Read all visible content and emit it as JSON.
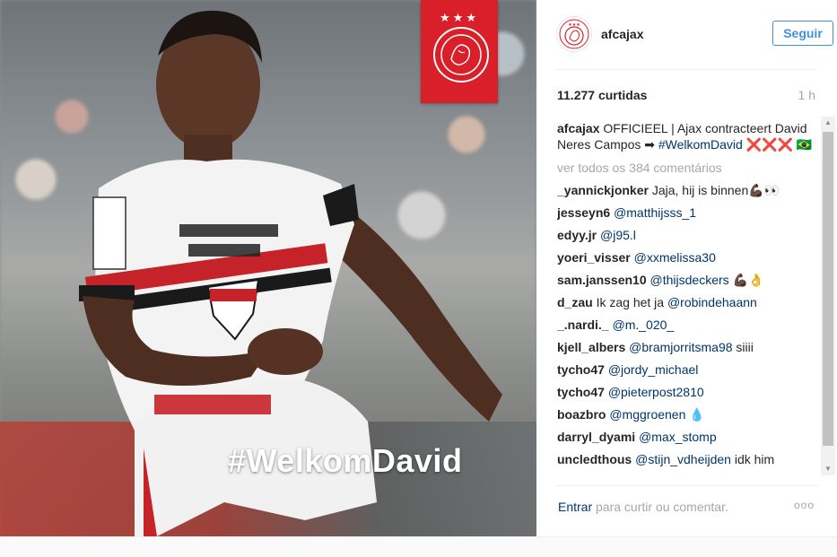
{
  "photo": {
    "hashtag_overlay": "#WelkomDavid",
    "badge_stars": "★★★"
  },
  "post": {
    "username": "afcajax",
    "follow_label": "Seguir",
    "likes": "11.277 curtidas",
    "time": "1 h",
    "caption": {
      "user": "afcajax",
      "text_before": " OFFICIEEL | Ajax contracteert David Neres Campos ➡ ",
      "hashtag": "#WelkomDavid",
      "text_after": " ❌❌❌ 🇧🇷"
    },
    "view_all": "ver todos os 384 comentários",
    "comments": [
      {
        "user": "_yannickjonker",
        "text": " Jaja, hij is binnen💪🏿👀"
      },
      {
        "user": "jesseyn6",
        "mention": "@matthijsss_1",
        "text": ""
      },
      {
        "user": "edyy.jr",
        "mention": "@j95.l",
        "text": ""
      },
      {
        "user": "yoeri_visser",
        "mention": "@xxmelissa30",
        "text": ""
      },
      {
        "user": "sam.janssen10",
        "mention": "@thijsdeckers",
        "text": " 💪🏿👌"
      },
      {
        "user": "d_zau",
        "text": " Ik zag het ja ",
        "mention": "@robindehaann"
      },
      {
        "user": "_.nardi._",
        "mention": "@m._020_",
        "text": ""
      },
      {
        "user": "kjell_albers",
        "mention": "@bramjorritsma98",
        "text": " siiii"
      },
      {
        "user": "tycho47",
        "mention": "@jordy_michael",
        "text": ""
      },
      {
        "user": "tycho47",
        "mention": "@pieterpost2810",
        "text": ""
      },
      {
        "user": "boazbro",
        "mention": "@mggroenen",
        "text": " 💧"
      },
      {
        "user": "darryl_dyami",
        "mention": "@max_stomp",
        "text": ""
      },
      {
        "user": "uncledthous",
        "mention": "@stijn_vdheijden",
        "text": " idk him"
      }
    ],
    "login_link": "Entrar",
    "login_rest": " para curtir ou comentar.",
    "more_icon": "ooo"
  }
}
